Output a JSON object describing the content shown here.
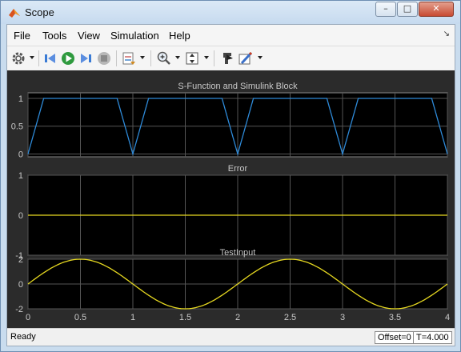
{
  "window": {
    "title": "Scope",
    "buttons": [
      "minimize",
      "maximize",
      "close"
    ]
  },
  "menu": {
    "items": [
      "File",
      "Tools",
      "View",
      "Simulation",
      "Help"
    ]
  },
  "toolbar": {
    "icons": [
      "gear-icon",
      "step-back-icon",
      "run-icon",
      "step-forward-icon",
      "stop-icon",
      "layout-icon",
      "zoom-icon",
      "scale-axes-icon",
      "highlight-icon",
      "style-icon"
    ]
  },
  "chart_data": [
    {
      "type": "line",
      "title": "S-Function and Simulink Block",
      "x": [
        0,
        0.15,
        0.85,
        1.0,
        1.15,
        1.85,
        2.0,
        2.15,
        2.85,
        3.0,
        3.15,
        3.85,
        4.0
      ],
      "series": [
        {
          "values": [
            0,
            1,
            1,
            0,
            1,
            1,
            0,
            1,
            1,
            0,
            1,
            1,
            0
          ],
          "color": "#2e8ad8"
        }
      ],
      "xlim": [
        0,
        4
      ],
      "ylim": [
        -0.05,
        1.1
      ],
      "yticks": [
        "1",
        "0.5",
        "0"
      ],
      "grid": true
    },
    {
      "type": "line",
      "title": "Error",
      "x": [
        0,
        4
      ],
      "series": [
        {
          "values": [
            0,
            0
          ],
          "color": "#e6d820"
        }
      ],
      "xlim": [
        0,
        4
      ],
      "ylim": [
        -1,
        1
      ],
      "yticks": [
        "1",
        "0",
        "-1"
      ],
      "grid": true
    },
    {
      "type": "line",
      "title": "TestInput",
      "function": "2*sin(pi*x)",
      "series": [
        {
          "color": "#e6d820"
        }
      ],
      "xlim": [
        0,
        4
      ],
      "ylim": [
        -2,
        2
      ],
      "yticks": [
        "2",
        "0",
        "-2"
      ],
      "xticks": [
        "0",
        "0.5",
        "1",
        "1.5",
        "2",
        "2.5",
        "3",
        "3.5",
        "4"
      ],
      "grid": true
    }
  ],
  "status": {
    "text": "Ready",
    "offset": "Offset=0",
    "time": "T=4.000"
  },
  "colors": {
    "plot_bg": "#000000",
    "figure_bg": "#2b2b2b",
    "grid": "#555555",
    "axis_text": "#c8c8c8"
  }
}
